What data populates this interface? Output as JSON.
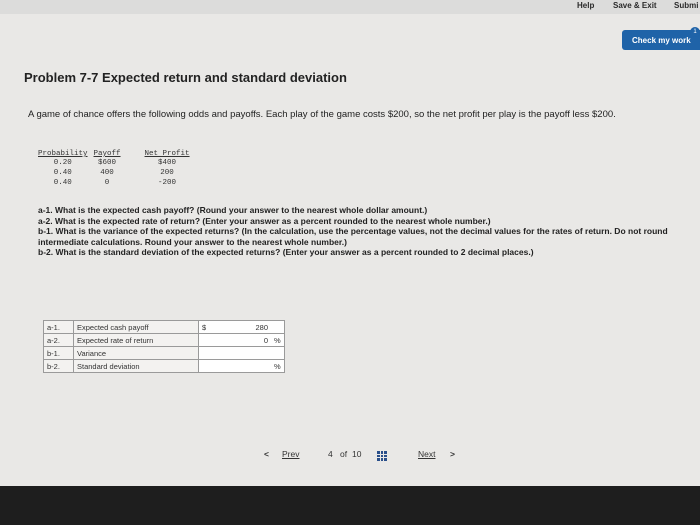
{
  "header": {
    "help": "Help",
    "save_exit": "Save & Exit",
    "submit": "Submi"
  },
  "check_button": "Check my work",
  "check_badge": "1",
  "title": "Problem 7-7 Expected return and standard deviation",
  "intro": "A game of chance offers the following odds and payoffs. Each play of the game costs $200, so the net profit per play is the payoff less $200.",
  "odds_table": {
    "headers": [
      "Probability",
      "Payoff",
      "Net Profit"
    ],
    "rows": [
      [
        "0.20",
        "$600",
        "$400"
      ],
      [
        "0.40",
        "400",
        "200"
      ],
      [
        "0.40",
        "0",
        "-200"
      ]
    ]
  },
  "questions": [
    {
      "id": "a-1.",
      "text": "What is the expected cash payoff?",
      "note": "(Round your answer to the nearest whole dollar amount.)"
    },
    {
      "id": "a-2.",
      "text": "What is the expected rate of return?",
      "note": "(Enter your answer as a percent rounded to the nearest whole number.)"
    },
    {
      "id": "b-1.",
      "text": "What is the variance of the expected returns?",
      "note": "(In the calculation, use the percentage values, not the decimal values for the rates of return. Do not round intermediate calculations. Round your answer to the nearest whole number.)"
    },
    {
      "id": "b-2.",
      "text": "What is the standard deviation of the expected returns?",
      "note": "(Enter your answer as a percent rounded to 2 decimal places.)"
    }
  ],
  "answers": [
    {
      "label": "a-1.",
      "desc": "Expected cash payoff",
      "currency": "$",
      "value": "280",
      "unit": ""
    },
    {
      "label": "a-2.",
      "desc": "Expected rate of return",
      "currency": "",
      "value": "0",
      "unit": "%"
    },
    {
      "label": "b-1.",
      "desc": "Variance",
      "currency": "",
      "value": "",
      "unit": ""
    },
    {
      "label": "b-2.",
      "desc": "Standard deviation",
      "currency": "",
      "value": "",
      "unit": "%"
    }
  ],
  "pagination": {
    "prev": "Prev",
    "prev_arrow": "<",
    "current": "4",
    "of": "of",
    "total": "10",
    "next": "Next",
    "next_arrow": ">"
  },
  "colors": {
    "accent": "#1f63a8",
    "background": "#e9e8e6"
  }
}
